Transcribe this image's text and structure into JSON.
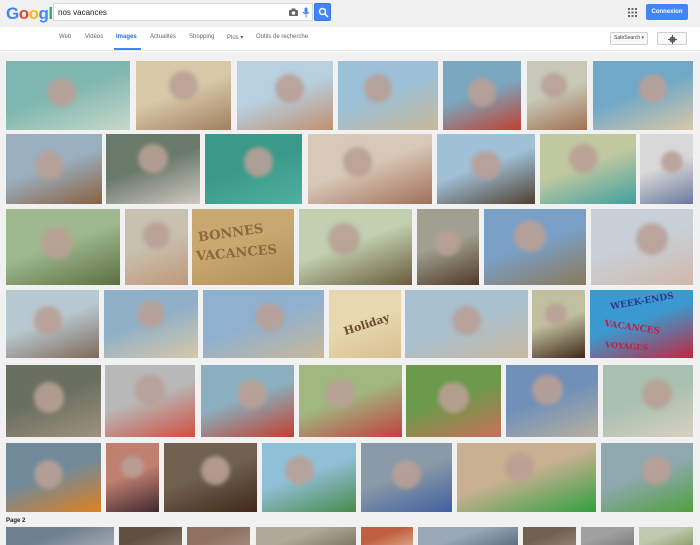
{
  "header": {
    "logo_text": "Google",
    "search_value": "nos vacances",
    "login_label": "Connexion"
  },
  "tabs": [
    {
      "label": "Web",
      "active": false
    },
    {
      "label": "Vidéos",
      "active": false
    },
    {
      "label": "Images",
      "active": true
    },
    {
      "label": "Actualités",
      "active": false
    },
    {
      "label": "Shopping",
      "active": false
    },
    {
      "label": "Plus ▾",
      "active": false
    },
    {
      "label": "Outils de recherche",
      "active": false
    }
  ],
  "safesearch_label": "SafeSearch ▾",
  "page2_label": "Page 2",
  "image_texts": {
    "sand_writing_line1": "BONNES",
    "sand_writing_line2": "VACANCES",
    "holiday_card": "Holiday",
    "sign_line1": "WEEK-ENDS",
    "sign_line2": "VACANCES",
    "sign_line3": "VOYAGES"
  },
  "colors": {
    "accent": "#4285f4",
    "active_tab": "#1a73e8",
    "background": "#f1f1f1",
    "logo": [
      "#4285f4",
      "#ea4335",
      "#fbbc05",
      "#4285f4",
      "#34a853",
      "#ea4335"
    ]
  },
  "icons": [
    "camera-icon",
    "mic-icon",
    "search-icon",
    "apps-icon",
    "gear-icon"
  ]
}
